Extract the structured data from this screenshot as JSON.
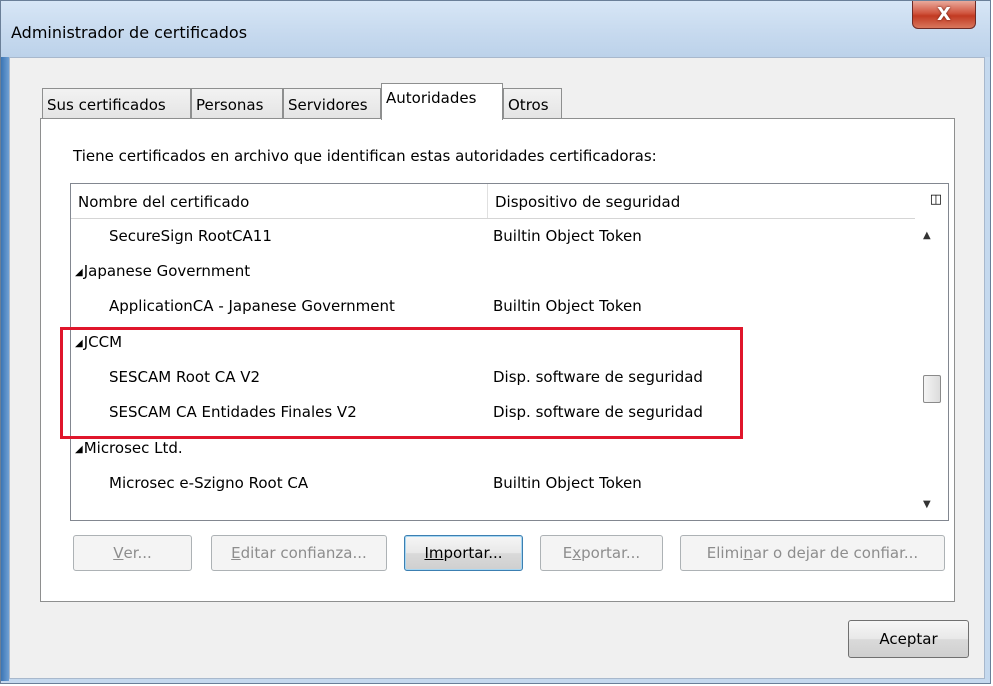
{
  "window": {
    "title": "Administrador de certificados",
    "close_glyph": "X"
  },
  "tabs": [
    {
      "label": "Sus certificados",
      "active": false
    },
    {
      "label": "Personas",
      "active": false
    },
    {
      "label": "Servidores",
      "active": false
    },
    {
      "label": "Autoridades",
      "active": true
    },
    {
      "label": "Otros",
      "active": false
    }
  ],
  "panel": {
    "intro": "Tiene certificados en archivo que identifican estas autoridades certificadoras:"
  },
  "tree": {
    "columns": [
      "Nombre del certificado",
      "Dispositivo de seguridad"
    ],
    "column_picker_icon": "column-picker-icon",
    "rows": [
      {
        "name": "SecureSign RootCA11",
        "device": "Builtin Object Token",
        "group": false
      },
      {
        "name": "Japanese Government",
        "device": "",
        "group": true
      },
      {
        "name": "ApplicationCA - Japanese Government",
        "device": "Builtin Object Token",
        "group": false
      },
      {
        "name": "JCCM",
        "device": "",
        "group": true
      },
      {
        "name": "SESCAM Root CA V2",
        "device": "Disp. software de seguridad",
        "group": false
      },
      {
        "name": "SESCAM CA Entidades Finales V2",
        "device": "Disp. software de seguridad",
        "group": false
      },
      {
        "name": "Microsec Ltd.",
        "device": "",
        "group": true
      },
      {
        "name": "Microsec e-Szigno Root CA",
        "device": "Builtin Object Token",
        "group": false
      }
    ],
    "highlight_color": "#e0162b"
  },
  "buttons": {
    "ver": {
      "pre": "",
      "u": "V",
      "post": "er..."
    },
    "editar": {
      "pre": "",
      "u": "E",
      "post": "ditar confianza..."
    },
    "importar": {
      "pre": "",
      "u": "Im",
      "post": "portar..."
    },
    "exportar": {
      "pre": "E",
      "u": "x",
      "post": "portar..."
    },
    "eliminar": {
      "pre": "Elimi",
      "u": "n",
      "post": "ar o dejar de confiar..."
    },
    "aceptar": "Aceptar"
  }
}
